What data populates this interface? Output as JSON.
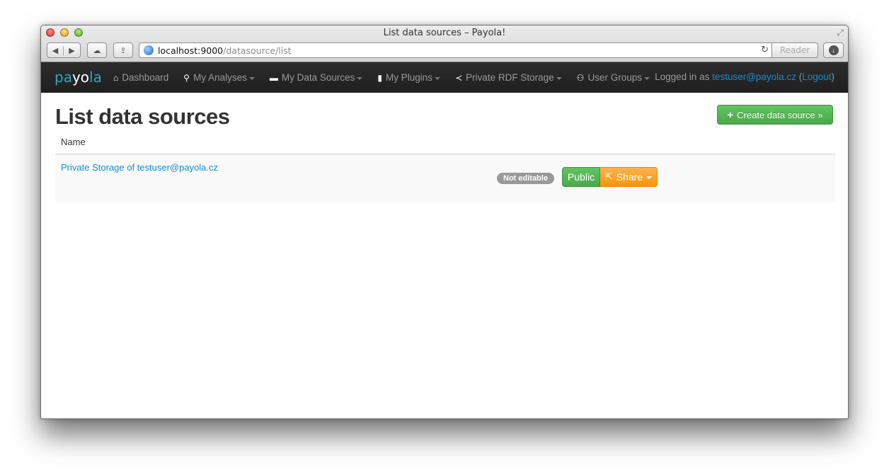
{
  "browser": {
    "window_title": "List data sources – Payola!",
    "url_host": "localhost:9000",
    "url_path": "/datasource/list",
    "reader_label": "Reader"
  },
  "navbar": {
    "brand_pre": "pa",
    "brand_o": "yo",
    "brand_post": "la",
    "items": [
      {
        "label": "Dashboard",
        "icon": "home-icon",
        "glyph": "⌂",
        "dropdown": false
      },
      {
        "label": "My Analyses",
        "icon": "search-icon",
        "glyph": "🔍︎",
        "dropdown": true
      },
      {
        "label": "My Data Sources",
        "icon": "hdd-icon",
        "glyph": "▬",
        "dropdown": true
      },
      {
        "label": "My Plugins",
        "icon": "file-icon",
        "glyph": "▮",
        "dropdown": true
      },
      {
        "label": "Private RDF Storage",
        "icon": "share-nodes-icon",
        "glyph": "<",
        "dropdown": true
      },
      {
        "label": "User Groups",
        "icon": "users-icon",
        "glyph": "👥︎",
        "dropdown": true
      }
    ],
    "logged_in_prefix": "Logged in as ",
    "user_email": "testuser@payola.cz",
    "logout_label": "Logout"
  },
  "main": {
    "title": "List data sources",
    "create_button": "Create data source »",
    "table": {
      "headers": [
        "Name"
      ],
      "rows": [
        {
          "name": "Private Storage of testuser@payola.cz",
          "badge": "Not editable",
          "visibility_button": "Public",
          "share_button": "Share"
        }
      ]
    }
  },
  "colors": {
    "link": "#0f8fd6",
    "success": "#5bb75b",
    "warning": "#f89406",
    "navbar_bg": "#222222",
    "brand": "#29a8c4"
  }
}
